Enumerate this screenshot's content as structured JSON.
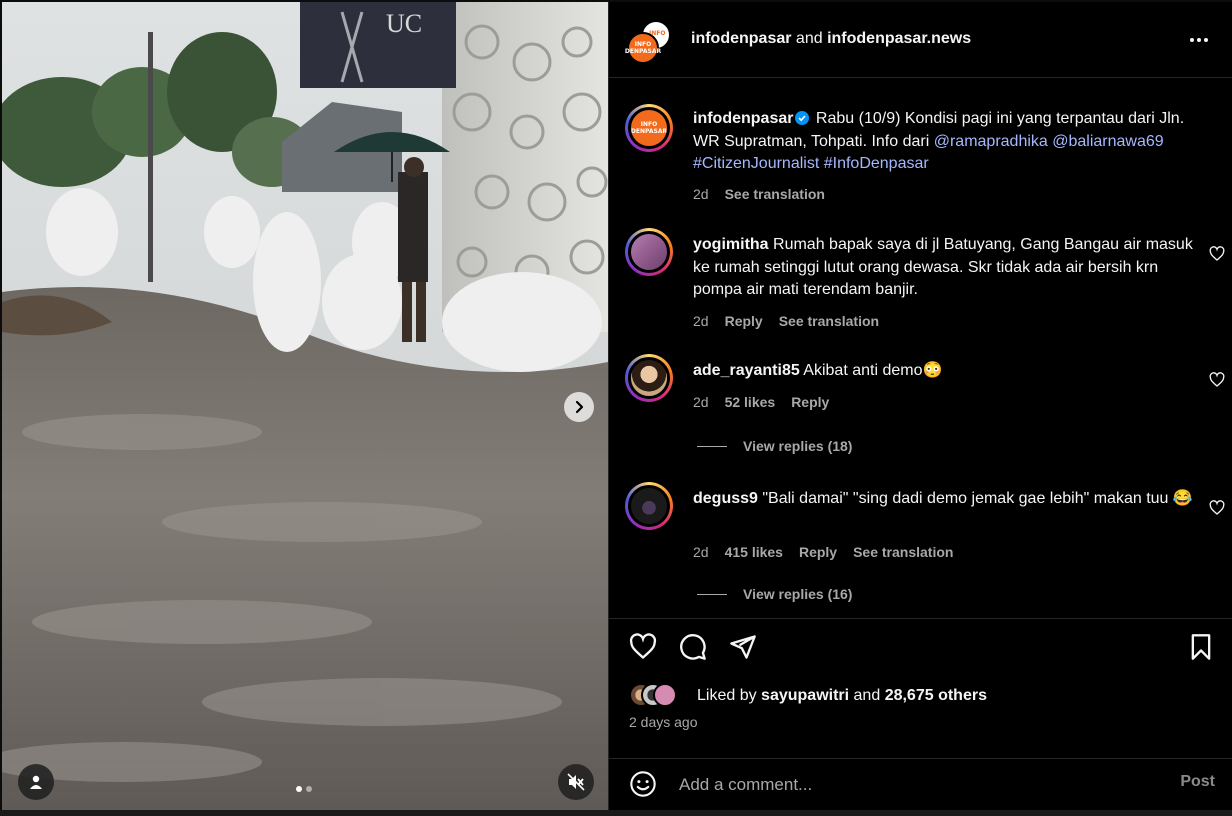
{
  "header": {
    "account_1": "infodenpasar",
    "joiner": "and",
    "account_2": "infodenpasar.news",
    "logo_line1": "INFO",
    "logo_line2": "DENPASAR"
  },
  "media": {
    "sign_text": "UC",
    "slide_count": 2,
    "active_slide": 1
  },
  "caption": {
    "username": "infodenpasar",
    "text": "Rabu (10/9) Kondisi pagi ini yang terpantau dari Jln. WR Supratman, Tohpati. Info dari",
    "mention_1": "@ramapradhika",
    "mention_2": "@baliarnawa69",
    "hashtag_1": "#CitizenJournalist",
    "hashtag_2": "#InfoDenpasar",
    "age": "2d",
    "translate": "See translation"
  },
  "comments": [
    {
      "username": "yogimitha",
      "text": "Rumah bapak saya di jl Batuyang, Gang Bangau air masuk ke rumah setinggi lutut orang dewasa. Skr tidak ada air bersih krn pompa air mati terendam banjir.",
      "age": "2d",
      "reply": "Reply",
      "translate": "See translation"
    },
    {
      "username": "ade_rayanti85",
      "text": "Akibat anti demo😳",
      "age": "2d",
      "likes": "52 likes",
      "reply": "Reply",
      "view_replies": "View replies (18)"
    },
    {
      "username": "deguss9",
      "text": "\"Bali damai\" \"sing dadi demo jemak gae lebih\" makan tuu 😂",
      "age": "2d",
      "likes": "415 likes",
      "reply": "Reply",
      "translate": "See translation",
      "view_replies": "View replies (16)"
    }
  ],
  "likes": {
    "prefix": "Liked by",
    "user": "sayupawitri",
    "joiner": "and",
    "others": "28,675 others",
    "time": "2 days ago"
  },
  "add_comment": {
    "placeholder": "Add a comment...",
    "post_label": "Post"
  },
  "icons": {
    "more": "more-options-icon",
    "like": "heart-icon",
    "comment": "comment-icon",
    "share": "send-icon",
    "save": "bookmark-icon",
    "emoji": "emoji-icon",
    "next": "chevron-right-icon",
    "user_tag": "user-icon",
    "mute": "speaker-muted-icon"
  },
  "colors": {
    "background": "#000000",
    "text": "#f5f5f5",
    "secondary": "#a8a8a8",
    "link": "#a5b8ff",
    "verified": "#0095f6",
    "brand_orange": "#f26b1d"
  }
}
